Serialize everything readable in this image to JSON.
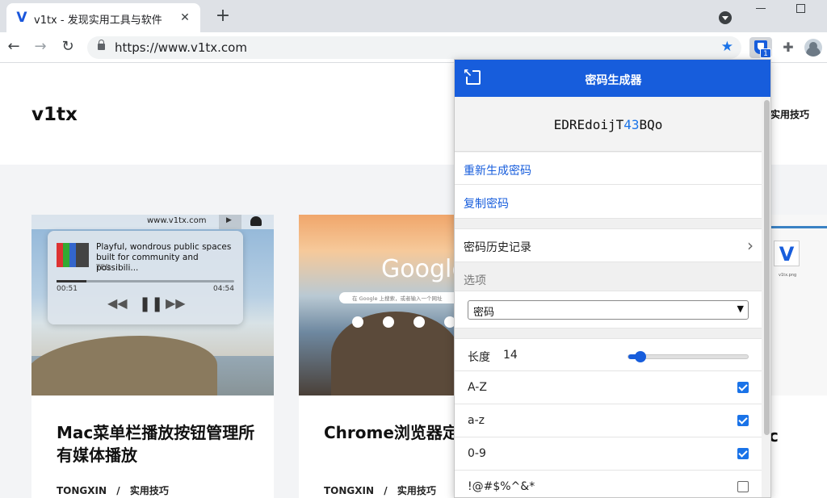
{
  "browser": {
    "tab_title": "v1tx - 发现实用工具与软件",
    "tab_favicon": "V",
    "url": "https://www.v1tx.com",
    "extension_badge": "1"
  },
  "site": {
    "logo": "v1tx",
    "nav_item": "实用技巧",
    "cards": [
      {
        "title": "Mac菜单栏播放按钮管理所有媒体播放",
        "author": "TONGXIN",
        "separator": "/",
        "category": "实用技巧",
        "image": {
          "url": "www.v1tx.com",
          "media_title": "Playful, wondrous public spaces built for community and possibili...",
          "media_source": "TED",
          "time_elapsed": "00:51",
          "time_total": "04:54",
          "progress": 0.17
        }
      },
      {
        "title": "Chrome浏览器定签页方法",
        "author": "TONGXIN",
        "separator": "/",
        "category": "实用技巧",
        "image": {
          "wordmark": "Google",
          "search_placeholder": "在 Google 上搜索，或者输入一个网址"
        }
      },
      {
        "title": "c",
        "image": {
          "logo": "V",
          "caption": "v1tx.png"
        }
      }
    ]
  },
  "popup": {
    "title": "密码生成器",
    "password_prefix": "EDREdoijT",
    "password_digits": "43",
    "password_suffix": "BQo",
    "regenerate": "重新生成密码",
    "copy": "复制密码",
    "history": "密码历史记录",
    "options_label": "选项",
    "type_select": "密码",
    "length_label": "长度",
    "length_value": "14",
    "length_slider_fraction": 0.1,
    "options": [
      {
        "label": "A-Z",
        "checked": true
      },
      {
        "label": "a-z",
        "checked": true
      },
      {
        "label": "0-9",
        "checked": true
      },
      {
        "label": "!@#$%^&*",
        "checked": false
      }
    ]
  },
  "colors": {
    "bitwarden_blue": "#175ddc",
    "checkbox_blue": "#1a73e8"
  }
}
